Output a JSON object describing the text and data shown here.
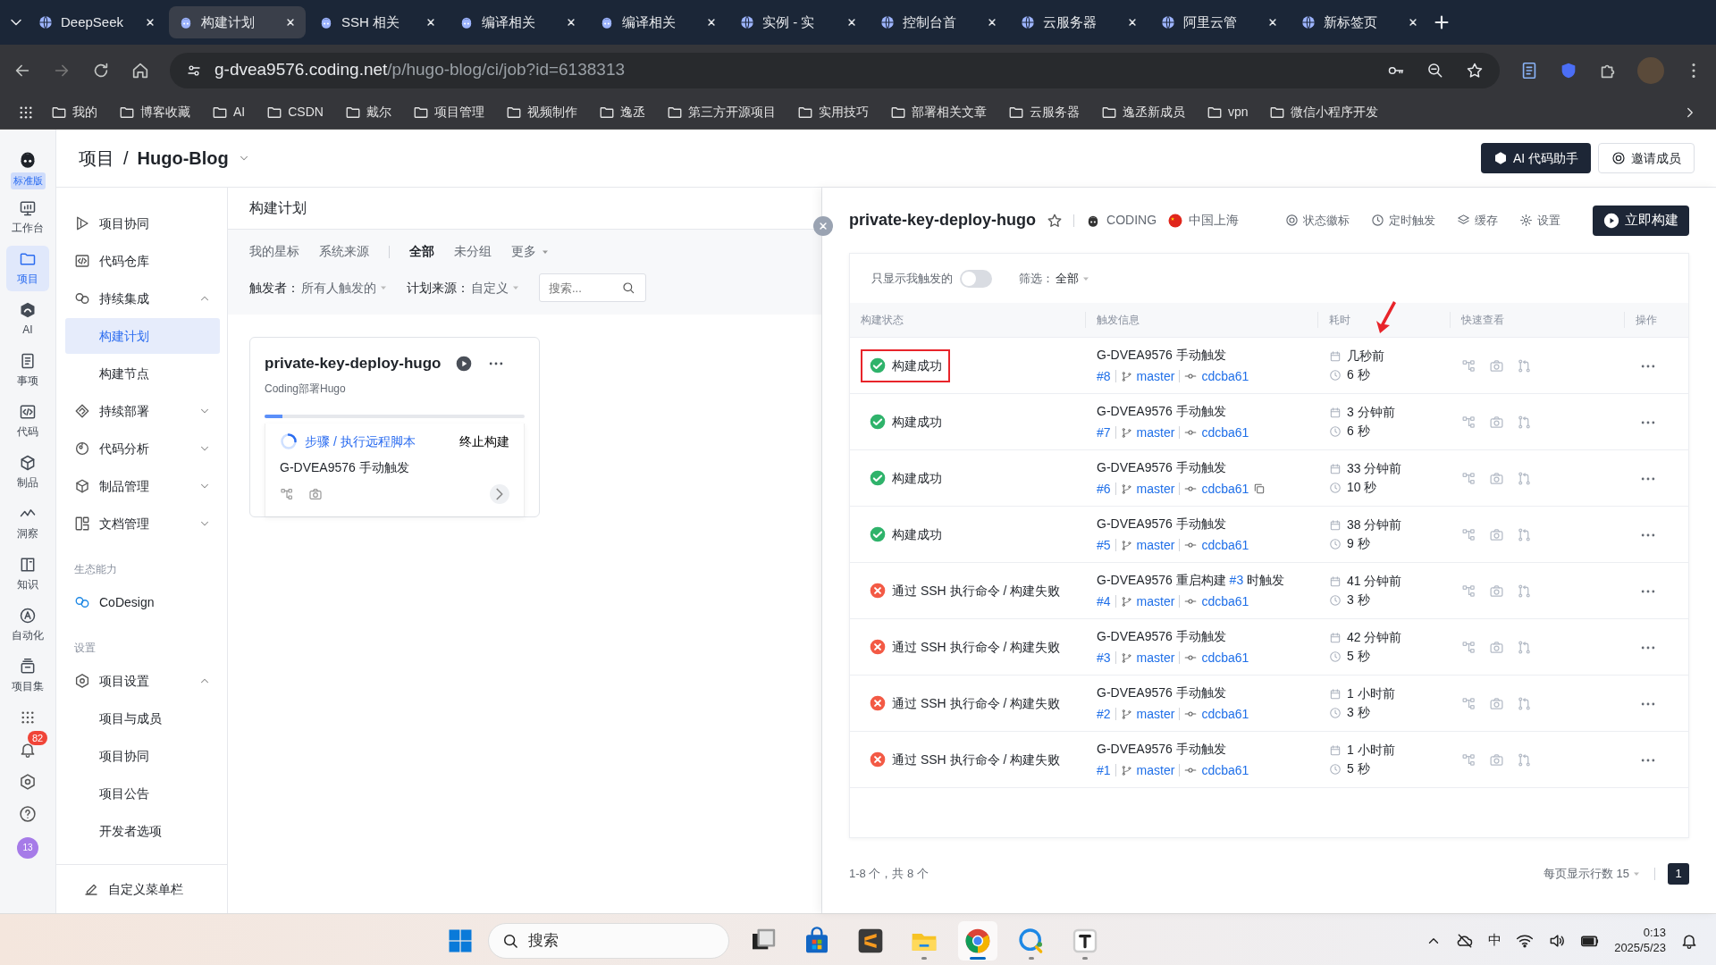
{
  "browser": {
    "tabs": [
      {
        "title": "DeepSeek",
        "selected": false
      },
      {
        "title": "构建计划",
        "selected": true
      },
      {
        "title": "SSH 相关",
        "selected": false
      },
      {
        "title": "编译相关",
        "selected": false
      },
      {
        "title": "编译相关",
        "selected": false
      },
      {
        "title": "实例 - 实",
        "selected": false
      },
      {
        "title": "控制台首",
        "selected": false
      },
      {
        "title": "云服务器",
        "selected": false
      },
      {
        "title": "阿里云管",
        "selected": false
      },
      {
        "title": "新标签页",
        "selected": false
      }
    ],
    "address": {
      "host": "g-dvea9576.coding.net",
      "path": "/p/hugo-blog/ci/job?id=6138313"
    },
    "bookmarks": [
      "我的",
      "博客收藏",
      "AI",
      "CSDN",
      "戴尔",
      "项目管理",
      "视频制作",
      "逸丞",
      "第三方开源项目",
      "实用技巧",
      "部署相关文章",
      "云服务器",
      "逸丞新成员",
      "vpn",
      "微信小程序开发"
    ]
  },
  "rail": {
    "edition": "标准版",
    "items": [
      {
        "label": "工作台",
        "selected": false
      },
      {
        "label": "项目",
        "selected": true
      },
      {
        "label": "AI",
        "selected": false
      },
      {
        "label": "事项",
        "selected": false
      },
      {
        "label": "代码",
        "selected": false
      },
      {
        "label": "制品",
        "selected": false
      },
      {
        "label": "洞察",
        "selected": false
      },
      {
        "label": "知识",
        "selected": false
      },
      {
        "label": "自动化",
        "selected": false
      },
      {
        "label": "项目集",
        "selected": false
      }
    ],
    "notifications": "82",
    "avatar": "13"
  },
  "header": {
    "breadcrumb": [
      "项目",
      "Hugo-Blog"
    ],
    "separator": "/",
    "buttons": [
      {
        "label": "AI 代码助手",
        "kind": "dark"
      },
      {
        "label": "邀请成员",
        "kind": "light"
      }
    ]
  },
  "nav": {
    "groups": [
      {
        "items": [
          {
            "label": "项目协同"
          },
          {
            "label": "代码仓库"
          },
          {
            "label": "持续集成",
            "expanded": true,
            "children": [
              {
                "label": "构建计划",
                "selected": true
              },
              {
                "label": "构建节点",
                "selected": false
              }
            ]
          },
          {
            "label": "持续部署",
            "expanded": false
          },
          {
            "label": "代码分析",
            "expanded": false
          },
          {
            "label": "制品管理",
            "expanded": false
          },
          {
            "label": "文档管理",
            "expanded": false
          }
        ]
      },
      {
        "title": "生态能力",
        "items": [
          {
            "label": "CoDesign"
          }
        ]
      },
      {
        "title": "设置",
        "items": [
          {
            "label": "项目设置",
            "expanded": true,
            "children": [
              {
                "label": "项目与成员",
                "selected": false
              },
              {
                "label": "项目协同",
                "selected": false
              },
              {
                "label": "项目公告",
                "selected": false
              },
              {
                "label": "开发者选项",
                "selected": false
              }
            ]
          }
        ]
      }
    ],
    "footer": "自定义菜单栏"
  },
  "plans": {
    "title": "构建计划",
    "tabs": [
      {
        "label": "我的星标",
        "selected": false
      },
      {
        "label": "系统来源",
        "selected": false
      },
      {
        "label": "全部",
        "selected": true,
        "divider_before": true
      },
      {
        "label": "未分组",
        "selected": false
      },
      {
        "label": "更多",
        "selected": false,
        "dropdown": true
      }
    ],
    "filters": [
      {
        "label": "触发者：",
        "value": "所有人触发的"
      },
      {
        "label": "计划来源：",
        "value": "自定义"
      }
    ],
    "search": {
      "placeholder": "搜索..."
    },
    "job": {
      "name": "private-key-deploy-hugo",
      "description": "Coding部署Hugo",
      "step": "步骤 / 执行远程脚本",
      "stop": "终止构建",
      "trigger": "G-DVEA9576 手动触发",
      "level": 0.07
    }
  },
  "detail": {
    "title": "private-key-deploy-hugo",
    "starred": false,
    "tags": [
      "CODING",
      "中国上海"
    ],
    "actions": [
      "状态徽标",
      "定时触发",
      "缓存",
      "设置"
    ],
    "primary": "立即构建",
    "toggle": {
      "label": "只显示我触发的",
      "on": false
    },
    "filter": {
      "label": "筛选：",
      "value": "全部"
    },
    "columns": [
      {
        "title": "构建状态",
        "marked": false
      },
      {
        "title": "触发信息",
        "marked": false
      },
      {
        "title": "耗时",
        "marked": true
      },
      {
        "title": "快速查看",
        "marked": false
      },
      {
        "title": "操作",
        "marked": false
      }
    ],
    "rows": [
      {
        "kind": "success",
        "status_text": "构建成功",
        "highlighted": true,
        "trigger": "G-DVEA9576 手动触发",
        "number": "#8",
        "branch": "master",
        "commit": "cdcba61",
        "time_ago": "几秒前",
        "duration": "6 秒"
      },
      {
        "kind": "success",
        "status_text": "构建成功",
        "highlighted": false,
        "trigger": "G-DVEA9576 手动触发",
        "number": "#7",
        "branch": "master",
        "commit": "cdcba61",
        "time_ago": "3 分钟前",
        "duration": "6 秒"
      },
      {
        "kind": "success",
        "status_text": "构建成功",
        "highlighted": false,
        "trigger": "G-DVEA9576 手动触发",
        "number": "#6",
        "branch": "master",
        "commit": "cdcba61",
        "copy": true,
        "time_ago": "33 分钟前",
        "duration": "10 秒"
      },
      {
        "kind": "success",
        "status_text": "构建成功",
        "highlighted": false,
        "trigger": "G-DVEA9576 手动触发",
        "number": "#5",
        "branch": "master",
        "commit": "cdcba61",
        "time_ago": "38 分钟前",
        "duration": "9 秒"
      },
      {
        "kind": "failed",
        "status_text": "通过 SSH 执行命令 / 构建失败",
        "highlighted": false,
        "trigger": "G-DVEA9576 重启构建",
        "trigger_ref": "#3",
        "trigger_tail": "时触发",
        "number": "#4",
        "branch": "master",
        "commit": "cdcba61",
        "time_ago": "41 分钟前",
        "duration": "3 秒"
      },
      {
        "kind": "failed",
        "status_text": "通过 SSH 执行命令 / 构建失败",
        "highlighted": false,
        "trigger": "G-DVEA9576 手动触发",
        "number": "#3",
        "branch": "master",
        "commit": "cdcba61",
        "time_ago": "42 分钟前",
        "duration": "5 秒"
      },
      {
        "kind": "failed",
        "status_text": "通过 SSH 执行命令 / 构建失败",
        "highlighted": false,
        "trigger": "G-DVEA9576 手动触发",
        "number": "#2",
        "branch": "master",
        "commit": "cdcba61",
        "time_ago": "1 小时前",
        "duration": "3 秒"
      },
      {
        "kind": "failed",
        "status_text": "通过 SSH 执行命令 / 构建失败",
        "highlighted": false,
        "trigger": "G-DVEA9576 手动触发",
        "number": "#1",
        "branch": "master",
        "commit": "cdcba61",
        "time_ago": "1 小时前",
        "duration": "5 秒"
      }
    ],
    "summary": "1-8 个，共 8 个",
    "page_size": "每页显示行数 15",
    "pages": [
      {
        "label": "1",
        "selected": true
      }
    ]
  },
  "taskbar": {
    "search": "搜索",
    "apps": [
      {
        "open": false,
        "active": false
      },
      {
        "open": false,
        "active": false
      },
      {
        "open": false,
        "active": false
      },
      {
        "open": true,
        "active": false
      },
      {
        "open": true,
        "active": true
      },
      {
        "open": true,
        "active": false
      },
      {
        "open": true,
        "active": false
      }
    ],
    "ime": "中",
    "time": "0:13",
    "date": "2025/5/23"
  }
}
